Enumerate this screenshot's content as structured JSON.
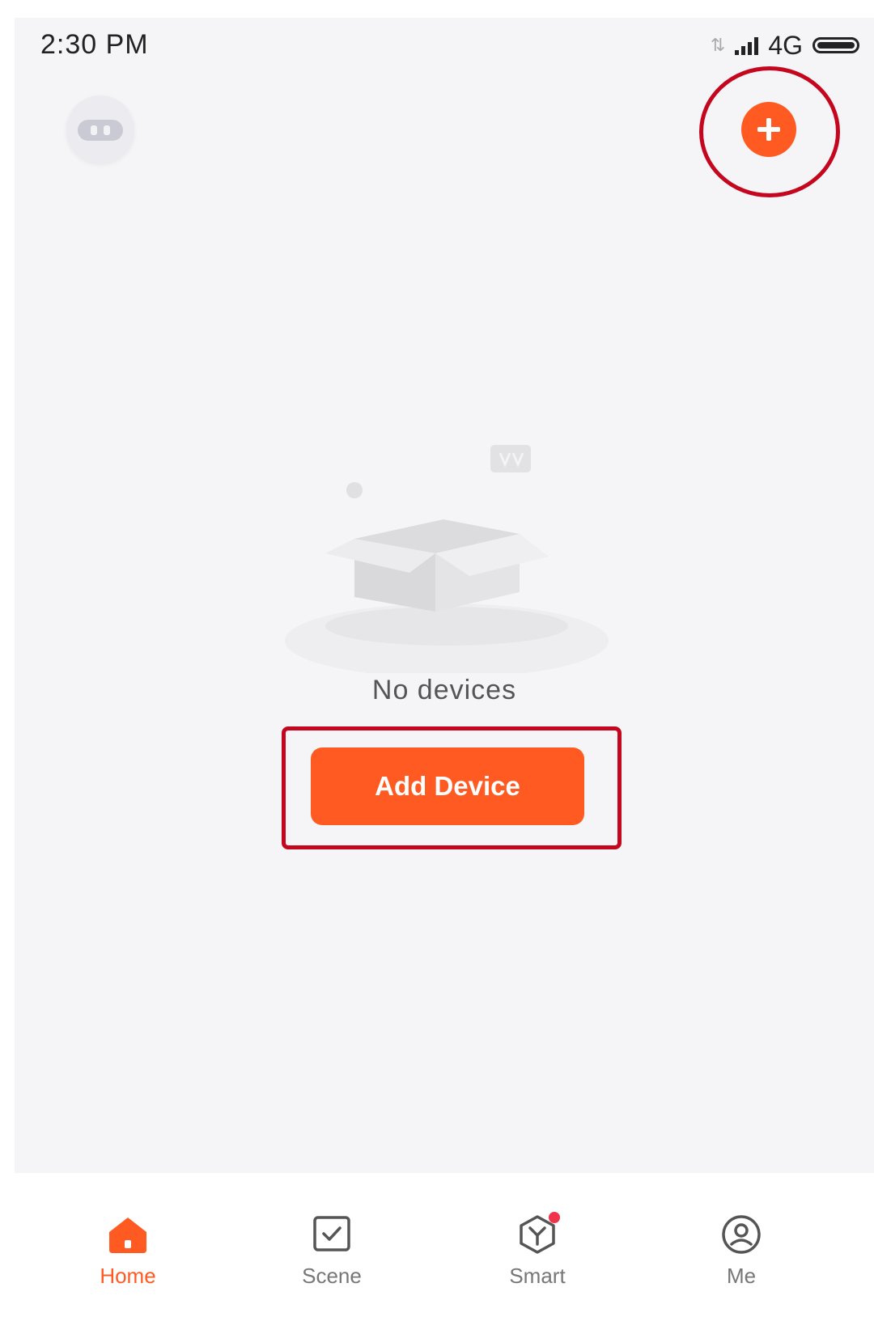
{
  "status_bar": {
    "time": "2:30  PM",
    "network": "4G"
  },
  "empty_state": {
    "message": "No devices",
    "button_label": "Add Device"
  },
  "tabs": [
    {
      "label": "Home",
      "active": true
    },
    {
      "label": "Scene",
      "active": false
    },
    {
      "label": "Smart",
      "active": false,
      "badge": true
    },
    {
      "label": "Me",
      "active": false
    }
  ],
  "colors": {
    "accent": "#ff5a22",
    "annotation": "#c4061e",
    "background": "#f5f5f7"
  },
  "icons": [
    "avatar-robot-icon",
    "plus-icon",
    "home-icon",
    "scene-icon",
    "smart-icon",
    "me-icon"
  ]
}
